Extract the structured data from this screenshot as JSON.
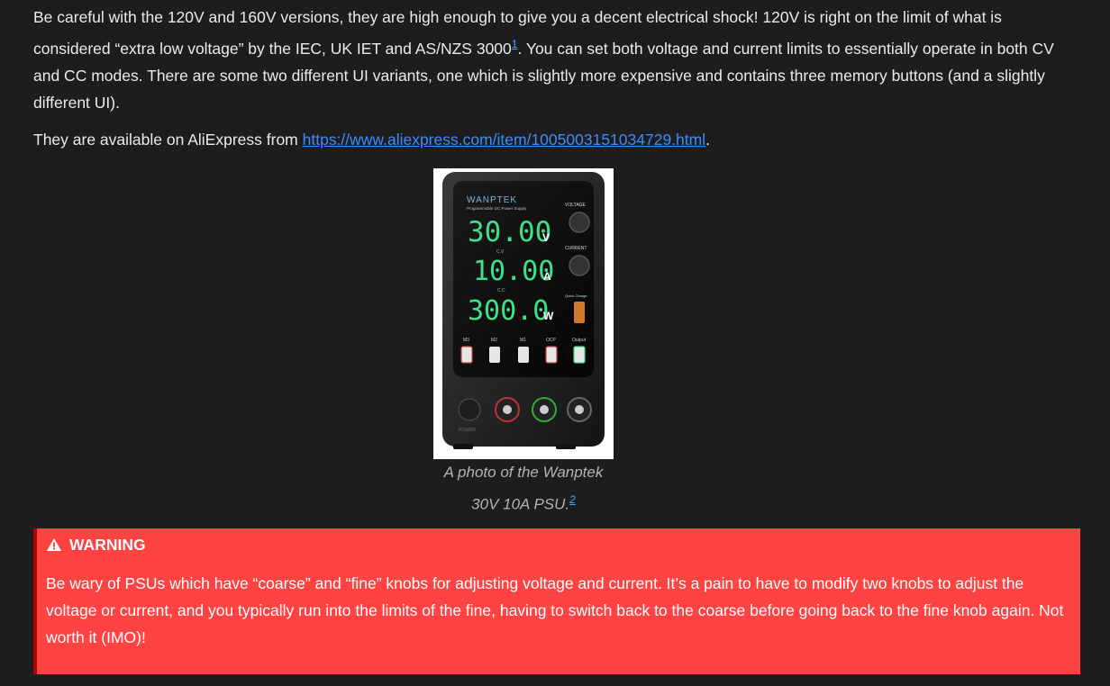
{
  "paragraphs": {
    "p1_text": "Be careful with the 120V and 160V versions, they are high enough to give you a decent electrical shock! 120V is right on the limit of what is considered “extra low voltage” by the IEC, UK IET and AS/NZS 3000",
    "p1_footnote": "1",
    "p1_rest": ". You can set both voltage and current limits to essentially operate in both CV and CC modes. There are some two different UI variants, one which is slightly more expensive and contains three memory buttons (and a slightly different UI).",
    "p2_text": "They are available on AliExpress from ",
    "p2_link": "https://www.aliexpress.com/item/1005003151034729.html",
    "p2_end": "."
  },
  "figure": {
    "device": {
      "brand": "WANPTEK",
      "subtitle": "Programmable DC Power Supply",
      "voltage_display": "30.00",
      "voltage_unit": "V",
      "current_display": "10.00",
      "current_unit": "A",
      "power_display": "300.0",
      "power_unit": "W",
      "cv_label": "C.V",
      "cc_label": "C.C",
      "voltage_knob_label": "VOLTAGE",
      "current_knob_label": "CURRENT",
      "quick_charge_label": "Quick Charge",
      "buttons": [
        "M3",
        "M2",
        "M1",
        "OCP",
        "Output"
      ],
      "power_label": "POWER"
    },
    "caption_line1": "A photo of the Wanptek",
    "caption_line2": "30V 10A PSU.",
    "caption_footnote": "2"
  },
  "warning": {
    "icon": "warning-triangle-icon",
    "title": "WARNING",
    "body": "Be wary of PSUs which have “coarse” and “fine” knobs for adjusting voltage and current. It’s a pain to have to modify two knobs to adjust the voltage or current, and you typically run into the limits of the fine, having to switch back to the coarse before going back to the fine knob again. Not worth it (IMO)!"
  },
  "colors": {
    "background": "#1d1d1d",
    "link": "#3d8cff",
    "warning_bg": "#ff4242",
    "warning_border": "#b30000",
    "display_green": "#3ee08a"
  }
}
